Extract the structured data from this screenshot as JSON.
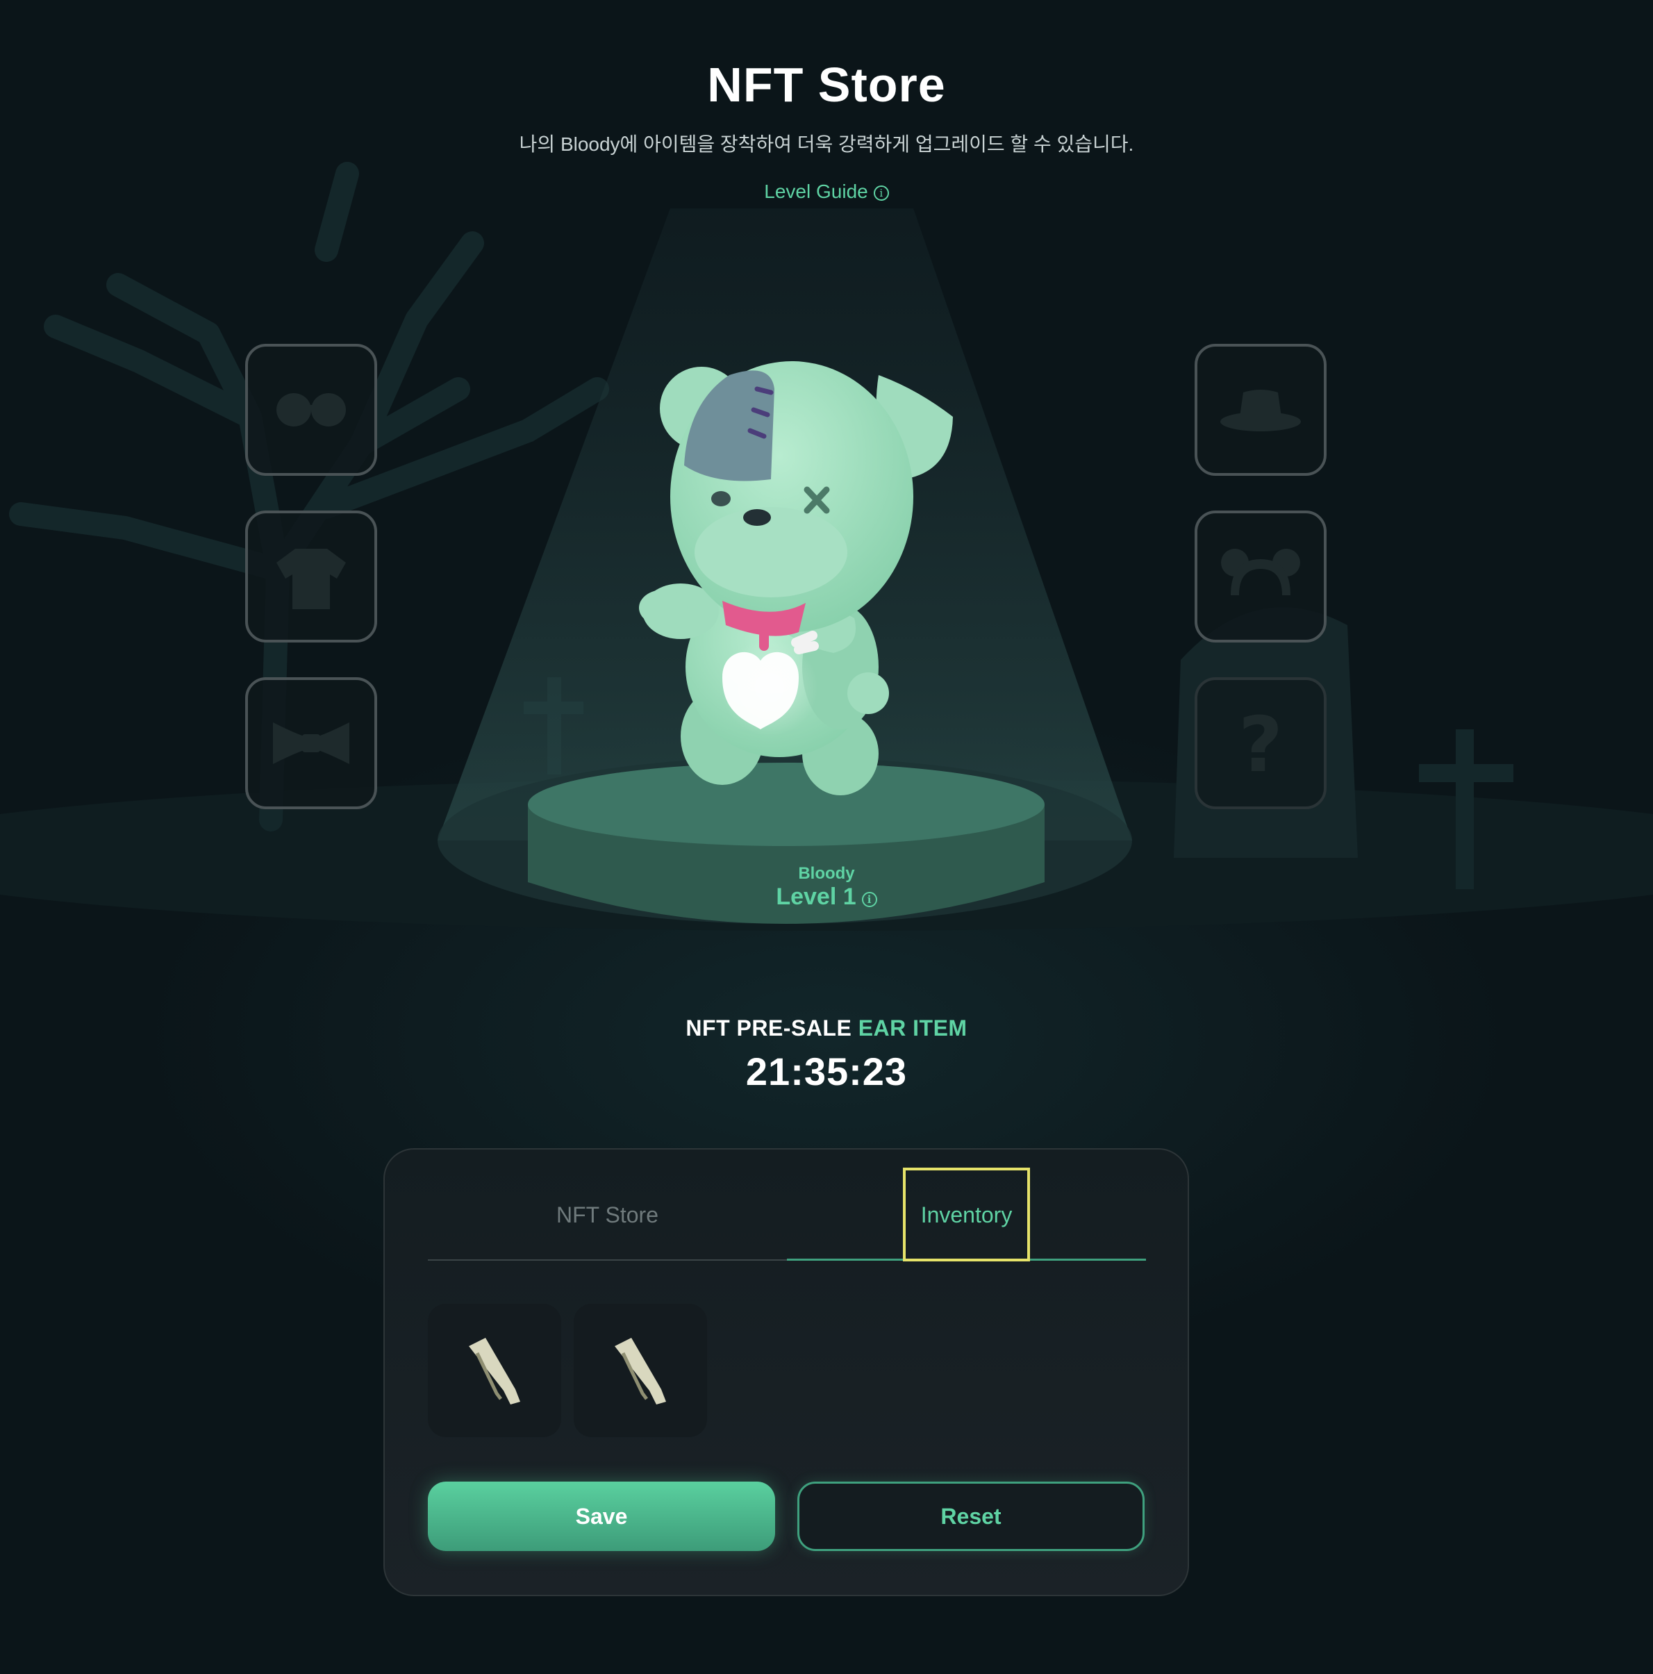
{
  "header": {
    "title": "NFT Store",
    "subtitle": "나의 Bloody에 아이템을 장착하여 더욱 강력하게 업그레이드 할 수 있습니다.",
    "level_guide_label": "Level Guide",
    "info_glyph": "i"
  },
  "slots": {
    "left": [
      {
        "icon": "glasses-icon"
      },
      {
        "icon": "shirt-icon"
      },
      {
        "icon": "bowtie-icon"
      }
    ],
    "right": [
      {
        "icon": "hat-icon"
      },
      {
        "icon": "ear-icon"
      },
      {
        "icon": "question-icon",
        "glyph": "?"
      }
    ]
  },
  "character": {
    "name": "Bloody",
    "level_label": "Level 1"
  },
  "presale": {
    "prefix": "NFT PRE-SALE",
    "highlight": "EAR ITEM",
    "countdown": "21:35:23"
  },
  "panel": {
    "tabs": [
      {
        "label": "NFT Store",
        "active": false
      },
      {
        "label": "Inventory",
        "active": true
      }
    ],
    "inventory_items": [
      {
        "icon": "ear-item-icon"
      },
      {
        "icon": "ear-item-icon"
      }
    ],
    "save_label": "Save",
    "reset_label": "Reset"
  },
  "colors": {
    "accent": "#5fd3a4",
    "background": "#0b1519",
    "highlight_box": "#e6e36a"
  }
}
